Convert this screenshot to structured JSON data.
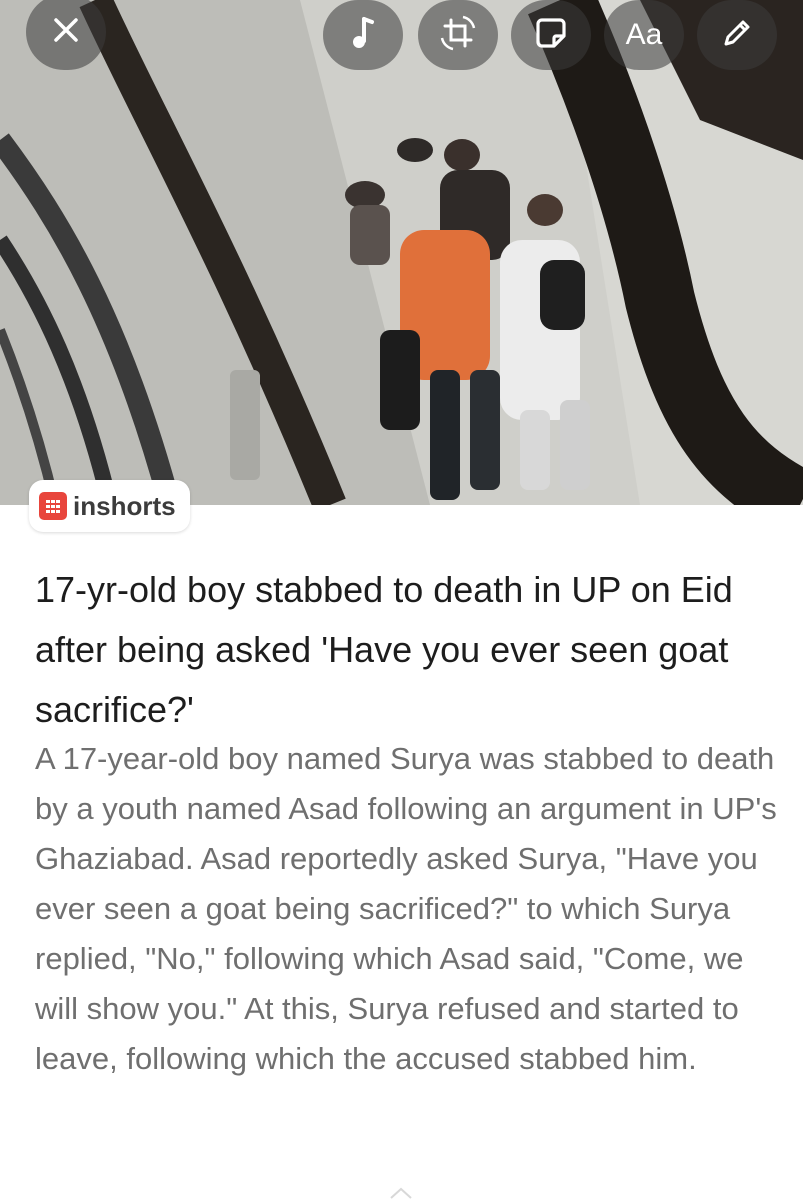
{
  "toolbar": {
    "close_icon": "close-icon",
    "music_icon": "music-note-icon",
    "crop_icon": "crop-rotate-icon",
    "sticker_icon": "sticker-icon",
    "text_label": "Aa",
    "draw_icon": "pencil-icon"
  },
  "photo": {
    "subject": "overhead-street-scene"
  },
  "brand": {
    "name": "inshorts",
    "color": "#e8453c"
  },
  "article": {
    "headline": "17-yr-old boy stabbed to death in UP on Eid after being asked 'Have you ever seen goat sacrifice?'",
    "summary": "A 17-year-old boy named Surya was stabbed to death by a youth named Asad following an argument in UP's Ghaziabad. Asad reportedly asked Surya, \"Have you ever seen a goat being sacrificed?\" to which Surya replied, \"No,\" following which Asad said, \"Come, we will show you.\" At this, Surya refused and started to leave, following which the accused stabbed him."
  },
  "colors": {
    "headline": "#1d1d1d",
    "summary": "#6f6f6f",
    "toolbar_bg": "#3c3c3c"
  }
}
